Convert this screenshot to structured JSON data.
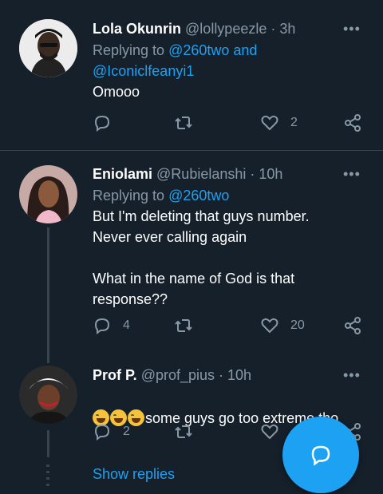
{
  "tweets": [
    {
      "name": "Lola Okunrin",
      "handle": "@lollypeezle",
      "time": "3h",
      "replying_prefix": "Replying to ",
      "replying_to_1": "@260two and",
      "replying_to_2": "@Iconiclfeanyi1",
      "text": "Omooo",
      "replies": "",
      "likes": "2"
    },
    {
      "name": "Eniolami",
      "handle": "@Rubielanshi",
      "time": "10h",
      "replying_prefix": "Replying to ",
      "replying_to_1": "@260two",
      "text": "But I'm deleting that guys number.\nNever ever calling again\n\nWhat in the name of God is that\nresponse??",
      "replies": "4",
      "likes": "20"
    },
    {
      "name": "Prof P.",
      "handle": "@prof_pius",
      "time": "10h",
      "text": "some guys go too extreme tho",
      "replies": "2",
      "likes": ""
    }
  ],
  "separator": " · ",
  "show_replies": "Show replies",
  "colors": {
    "background": "#15202b",
    "accent": "#1da1f2",
    "muted": "#8899a6"
  },
  "icons": [
    "more-icon",
    "reply-icon",
    "retweet-icon",
    "like-icon",
    "share-icon",
    "compose-reply-icon",
    "laughing-emoji-icon"
  ]
}
